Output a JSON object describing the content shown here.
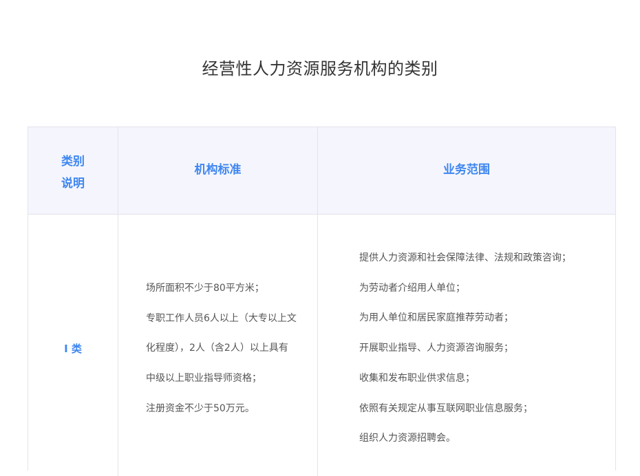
{
  "page": {
    "title": "经营性人力资源服务机构的类别"
  },
  "table": {
    "headers": {
      "category_line1": "类别",
      "category_line2": "说明",
      "standard": "机构标准",
      "scope": "业务范围"
    },
    "rows": [
      {
        "category": "I 类",
        "standard_lines": [
          "场所面积不少于80平方米；",
          "专职工作人员6人以上（大专以上文",
          "化程度），2人（含2人）以上具有",
          "中级以上职业指导师资格；",
          "注册资金不少于50万元。"
        ],
        "scope_lines": [
          "提供人力资源和社会保障法律、法规和政策咨询；",
          "为劳动者介绍用人单位；",
          "为用人单位和居民家庭推荐劳动者；",
          "开展职业指导、人力资源咨询服务；",
          "收集和发布职业供求信息；",
          "依照有关规定从事互联网职业信息服务；",
          "组织人力资源招聘会。"
        ]
      }
    ]
  },
  "colors": {
    "accent": "#3e86f0",
    "header_bg": "#f5f6fd",
    "border": "#e3e3ea"
  }
}
